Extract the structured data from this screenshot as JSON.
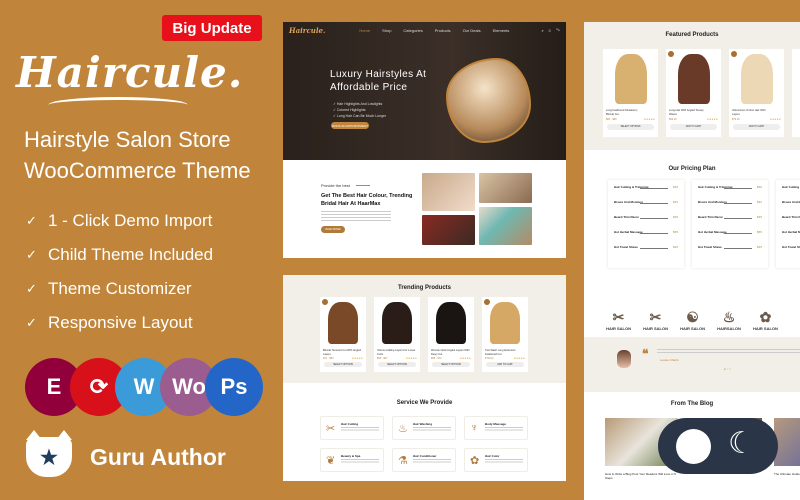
{
  "promo": {
    "badge": "Big Update",
    "logo": "Haircule.",
    "title_line1": "Hairstyle Salon Store",
    "title_line2": "WooCommerce Theme",
    "features": [
      "1 - Click Demo Import",
      "Child Theme Included",
      "Theme Customizer",
      "Responsive Layout"
    ],
    "tech_icons": [
      {
        "name": "elementor-icon",
        "glyph": "E",
        "color": "#92003b"
      },
      {
        "name": "sync-icon",
        "glyph": "⟳",
        "color": "#d8101a"
      },
      {
        "name": "wordpress-icon",
        "glyph": "W",
        "color": "#3a9bd8"
      },
      {
        "name": "woocommerce-icon",
        "glyph": "Wo",
        "color": "#9b5c8f"
      },
      {
        "name": "photoshop-icon",
        "glyph": "Ps",
        "color": "#2466c8"
      }
    ],
    "author": "Guru Author"
  },
  "hero": {
    "brand": "Haircule.",
    "nav": [
      "Home",
      "Shop",
      "Categories",
      "Products",
      "Our Deals",
      "Elements"
    ],
    "headline1": "Luxury Hairstyles At",
    "headline2": "Affordable Price",
    "bullets": [
      "Hair Highlights And Lowlights",
      "Colored Highlights",
      "Long Hair Can Be Much Longer"
    ],
    "cta": "BOOK AN APPOINTMENT"
  },
  "about": {
    "tag": "Provide the best",
    "heading": "Get The Best Hair Colour, Trending Bridal Hair At HaarMax",
    "cta": "READ MORE"
  },
  "trending": {
    "title": "Trending Products",
    "products": [
      {
        "name": "Blonde Textured Cut With Angled Layers",
        "price": "$70 - $84",
        "button": "SELECT OPTIONS",
        "color": "#7a4a28"
      },
      {
        "name": "Volume Adding Layers For Loose Curls",
        "price": "$55 - $67",
        "button": "SELECT OPTIONS",
        "color": "#2a1d18"
      },
      {
        "name": "Woman Neck Angled Layers With Dewy Cut",
        "price": "$58 - $72",
        "button": "SELECT OPTIONS",
        "color": "#1a1412"
      },
      {
        "name": "Two Wash Long Extension Feathered Cut",
        "price": "$ 59.00",
        "button": "ADD TO CART",
        "color": "#d6a865"
      }
    ]
  },
  "services": {
    "title": "Service We Provide",
    "items": [
      {
        "name": "Hair Cutting",
        "icon": "✂"
      },
      {
        "name": "Hair Washing",
        "icon": "♨"
      },
      {
        "name": "Body Massage",
        "icon": "♆"
      },
      {
        "name": "Beauty & Spa",
        "icon": "❦"
      },
      {
        "name": "Hair Conditioner",
        "icon": "⚗"
      },
      {
        "name": "Hair Color",
        "icon": "✿"
      }
    ]
  },
  "featured": {
    "title": "Featured Products",
    "products": [
      {
        "name": "Long Feathered Strawberry Blonde Cut",
        "price": "$80 - $89",
        "button": "SELECT OPTIONS",
        "color": "#d8b070"
      },
      {
        "name": "Long Hair With Angled Tousey Waves",
        "price": "$69.00",
        "button": "ADD TO CART",
        "color": "#6a3a28"
      },
      {
        "name": "Voluminous Ombre Hair With Layers",
        "price": "$79.00",
        "button": "ADD TO CART",
        "color": "#ecd8b4"
      }
    ]
  },
  "pricing": {
    "title": "Our Pricing Plan",
    "rows": [
      {
        "name": "Hair Cutting & Trimming",
        "price": "$30"
      },
      {
        "name": "Brows And Moisture",
        "price": "$32"
      },
      {
        "name": "Beard Trim Razor",
        "price": "$35"
      },
      {
        "name": "Hot Herbal Massage",
        "price": "$55"
      },
      {
        "name": "Hot Towel Shave",
        "price": "$25"
      }
    ]
  },
  "brands": [
    "HAIR SALON",
    "HAIR SALON",
    "HAIR SALON",
    "HAIRSALON",
    "HAIR SALON"
  ],
  "testimonial": {
    "author": "Louise Charlo"
  },
  "blog": {
    "title": "From The Blog",
    "posts": [
      "How to Write a Blog Post Your Readers Will Love in 5 Steps",
      "The Ultimate Guide to Hair Strategies"
    ]
  },
  "theme_toggle": {
    "mode": "light"
  }
}
